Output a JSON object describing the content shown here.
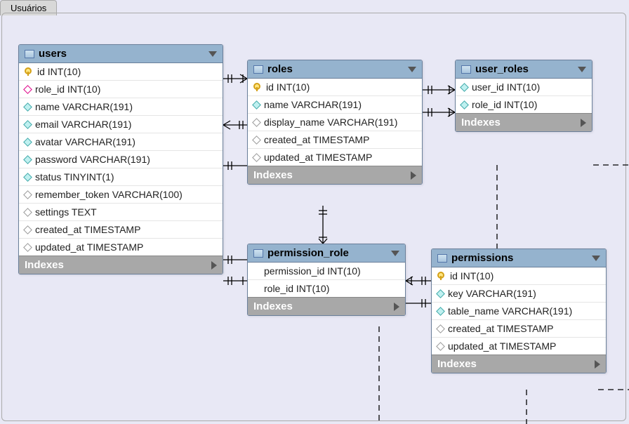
{
  "tab_label": "Usuários",
  "indexes_label": "Indexes",
  "tables": {
    "users": {
      "title": "users",
      "columns": [
        {
          "icon": "key",
          "text": "id INT(10)"
        },
        {
          "icon": "pink",
          "text": "role_id INT(10)"
        },
        {
          "icon": "filled",
          "text": "name VARCHAR(191)"
        },
        {
          "icon": "filled",
          "text": "email VARCHAR(191)"
        },
        {
          "icon": "filled",
          "text": "avatar VARCHAR(191)"
        },
        {
          "icon": "filled",
          "text": "password VARCHAR(191)"
        },
        {
          "icon": "filled",
          "text": "status TINYINT(1)"
        },
        {
          "icon": "empty",
          "text": "remember_token VARCHAR(100)"
        },
        {
          "icon": "empty",
          "text": "settings TEXT"
        },
        {
          "icon": "empty",
          "text": "created_at TIMESTAMP"
        },
        {
          "icon": "empty",
          "text": "updated_at TIMESTAMP"
        }
      ]
    },
    "roles": {
      "title": "roles",
      "columns": [
        {
          "icon": "key",
          "text": "id INT(10)"
        },
        {
          "icon": "filled",
          "text": "name VARCHAR(191)"
        },
        {
          "icon": "empty",
          "text": "display_name VARCHAR(191)"
        },
        {
          "icon": "empty",
          "text": "created_at TIMESTAMP"
        },
        {
          "icon": "empty",
          "text": "updated_at TIMESTAMP"
        }
      ]
    },
    "user_roles": {
      "title": "user_roles",
      "columns": [
        {
          "icon": "filled",
          "text": "user_id INT(10)"
        },
        {
          "icon": "filled",
          "text": "role_id INT(10)"
        }
      ]
    },
    "permission_role": {
      "title": "permission_role",
      "columns": [
        {
          "icon": "none",
          "text": "permission_id INT(10)"
        },
        {
          "icon": "none",
          "text": "role_id INT(10)"
        }
      ]
    },
    "permissions": {
      "title": "permissions",
      "columns": [
        {
          "icon": "key",
          "text": "id INT(10)"
        },
        {
          "icon": "filled",
          "text": "key VARCHAR(191)"
        },
        {
          "icon": "filled",
          "text": "table_name VARCHAR(191)"
        },
        {
          "icon": "empty",
          "text": "created_at TIMESTAMP"
        },
        {
          "icon": "empty",
          "text": "updated_at TIMESTAMP"
        }
      ]
    }
  }
}
